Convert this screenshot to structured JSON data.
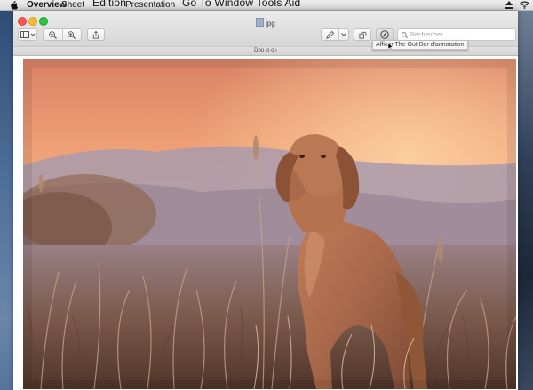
{
  "menubar": {
    "items": [
      {
        "label": "Overview",
        "style": "bold"
      },
      {
        "label": "Sheet"
      },
      {
        "label": "Edition"
      },
      {
        "label": "Presentation"
      },
      {
        "label": "Go To Window Tools Aid"
      }
    ],
    "status_icons": [
      "eject-icon",
      "wifi-icon"
    ]
  },
  "window": {
    "title": "jpg",
    "tab_label": "Doo lo o ı",
    "toolbar": {
      "buttons": [
        {
          "icon": "sidebar-icon"
        },
        {
          "icon": "zoom-out-icon"
        },
        {
          "icon": "zoom-in-icon"
        },
        {
          "icon": "share-icon"
        },
        {
          "icon": "markup-pen-icon"
        },
        {
          "icon": "rotate-icon"
        },
        {
          "icon": "annotate-circle-icon"
        }
      ]
    },
    "search": {
      "placeholder": "Rechercher",
      "value": ""
    },
    "tooltip": "Afficar The Out Bar d'annotation"
  },
  "colors": {
    "traffic_close": "#f25a52",
    "traffic_minimize": "#f6bb2f",
    "traffic_maximize": "#2cc640",
    "sky_top": "#d9876b",
    "sky_bottom": "#f0b282",
    "dog": "#a8684a"
  }
}
